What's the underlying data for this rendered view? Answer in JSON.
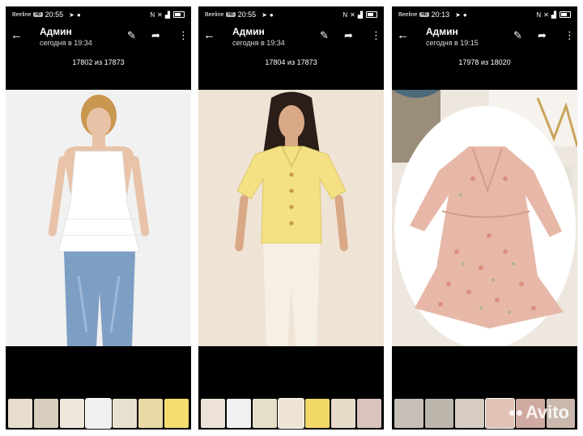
{
  "status": {
    "carrier": "Beeline",
    "network": "HD"
  },
  "toolbar": {
    "title": "Админ",
    "back_icon": "arrow-left-icon",
    "edit_icon": "brush-icon",
    "share_icon": "share-icon",
    "menu_icon": "more-vert-icon"
  },
  "panels": [
    {
      "time": "20:55",
      "subtitle": "сегодня в 19:34",
      "counter": "17802 из 17873"
    },
    {
      "time": "20:55",
      "subtitle": "сегодня в 19:34",
      "counter": "17804 из 17873"
    },
    {
      "time": "20:13",
      "subtitle": "сегодня в 19:15",
      "counter": "17978 из 18020"
    }
  ],
  "watermark": {
    "text": "Avito"
  },
  "colors": {
    "background": "#000000",
    "text": "#ffffff"
  }
}
